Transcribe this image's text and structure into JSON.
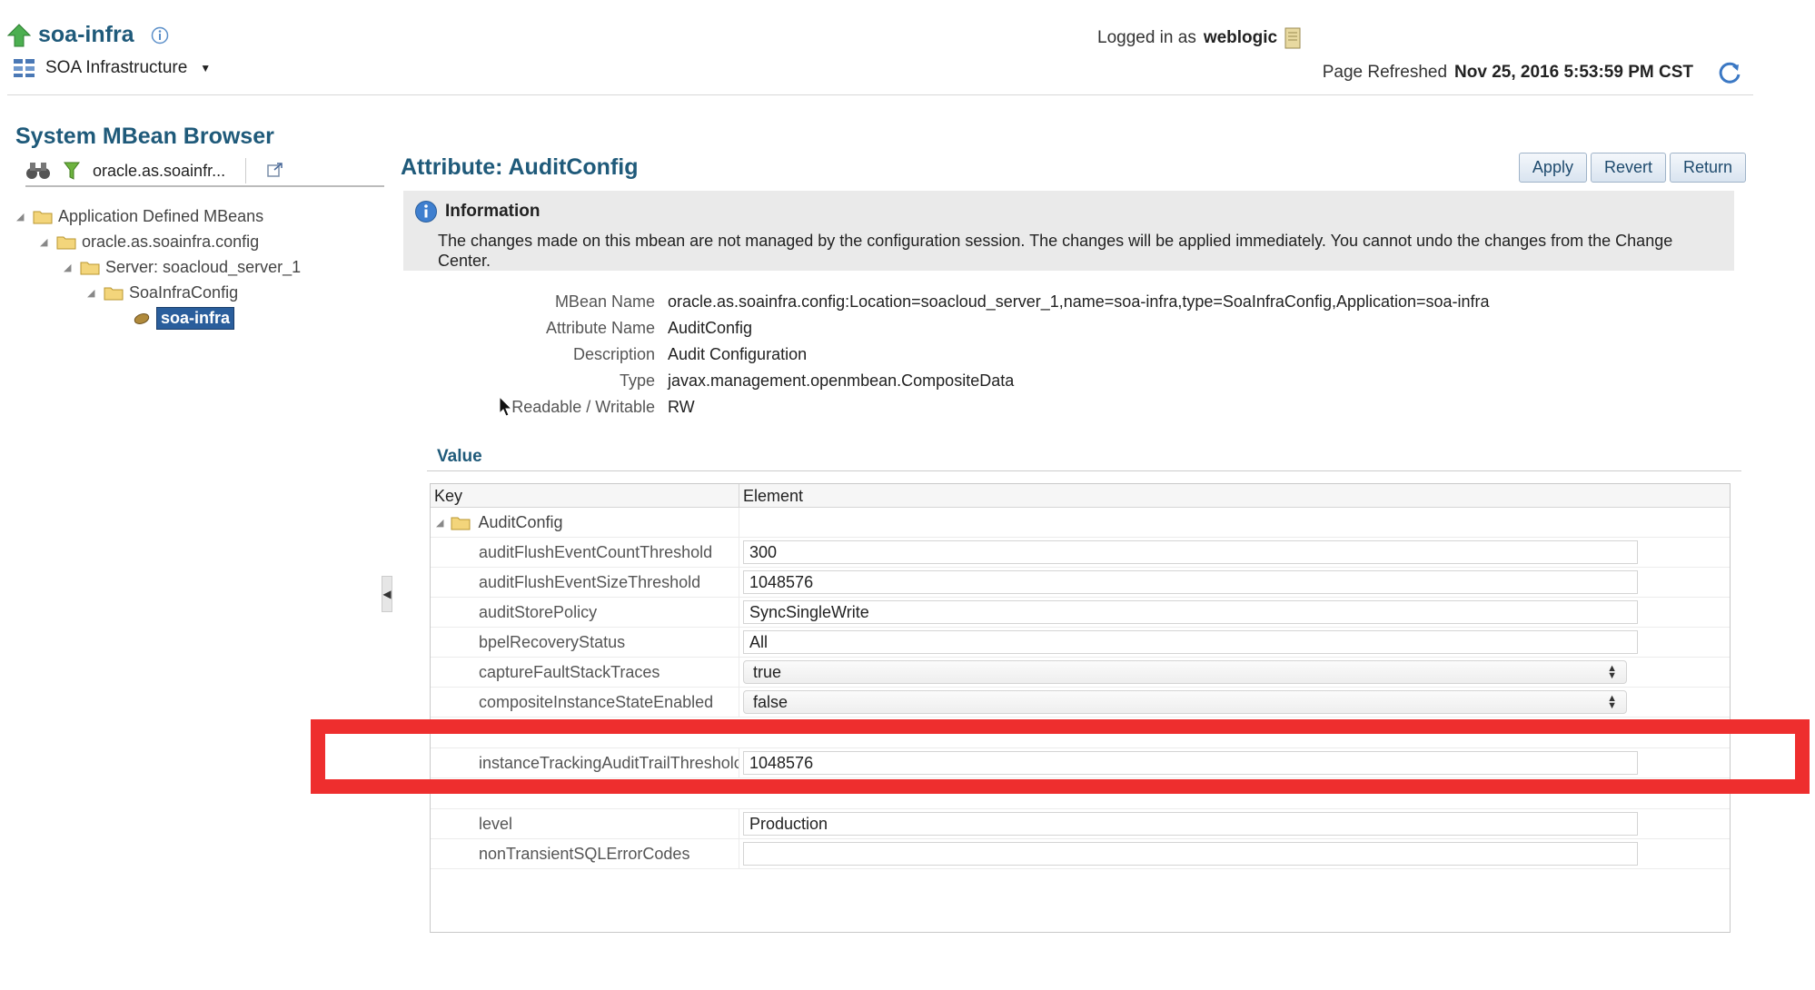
{
  "header": {
    "app_name": "soa-infra",
    "menu_label": "SOA Infrastructure",
    "logged_in_prefix": "Logged in as",
    "user": "weblogic",
    "refresh_prefix": "Page Refreshed",
    "refresh_time": "Nov 25, 2016 5:53:59 PM CST"
  },
  "left_panel": {
    "title": "System MBean Browser",
    "search_value": "oracle.as.soainfr...",
    "tree": [
      {
        "label": "Application Defined MBeans",
        "level": 0
      },
      {
        "label": "oracle.as.soainfra.config",
        "level": 1
      },
      {
        "label": "Server: soacloud_server_1",
        "level": 2
      },
      {
        "label": "SoaInfraConfig",
        "level": 3
      },
      {
        "label": "soa-infra",
        "level": 4,
        "selected": true
      }
    ]
  },
  "main": {
    "title": "Attribute: AuditConfig",
    "buttons": {
      "apply": "Apply",
      "revert": "Revert",
      "return": "Return"
    },
    "info": {
      "heading": "Information",
      "body": "The changes made on this mbean are not managed by the configuration session. The changes will be applied immediately. You cannot undo the changes from the Change Center."
    },
    "properties": [
      {
        "label": "MBean Name",
        "value": "oracle.as.soainfra.config:Location=soacloud_server_1,name=soa-infra,type=SoaInfraConfig,Application=soa-infra"
      },
      {
        "label": "Attribute Name",
        "value": "AuditConfig"
      },
      {
        "label": "Description",
        "value": "Audit Configuration"
      },
      {
        "label": "Type",
        "value": "javax.management.openmbean.CompositeData"
      },
      {
        "label": "Readable / Writable",
        "value": "RW"
      }
    ],
    "value_title": "Value",
    "grid": {
      "col_key": "Key",
      "col_element": "Element",
      "group": "AuditConfig",
      "rows": [
        {
          "key": "auditFlushEventCountThreshold",
          "value": "300",
          "kind": "text"
        },
        {
          "key": "auditFlushEventSizeThreshold",
          "value": "1048576",
          "kind": "text"
        },
        {
          "key": "auditStorePolicy",
          "value": "SyncSingleWrite",
          "kind": "text"
        },
        {
          "key": "bpelRecoveryStatus",
          "value": "All",
          "kind": "text"
        },
        {
          "key": "captureFaultStackTraces",
          "value": "true",
          "kind": "select"
        },
        {
          "key": "compositeInstanceStateEnabled",
          "value": "false",
          "kind": "select"
        },
        {
          "key": "instanceTrackingAuditTrailThresholc",
          "value": "1048576",
          "kind": "text"
        },
        {
          "key": "level",
          "value": "Production",
          "kind": "text"
        },
        {
          "key": "nonTransientSQLErrorCodes",
          "value": "",
          "kind": "text"
        }
      ]
    }
  },
  "colors": {
    "title_blue": "#1f5a7a",
    "highlight_red": "#ee2e2e",
    "selected_bg": "#2a5e9c"
  }
}
